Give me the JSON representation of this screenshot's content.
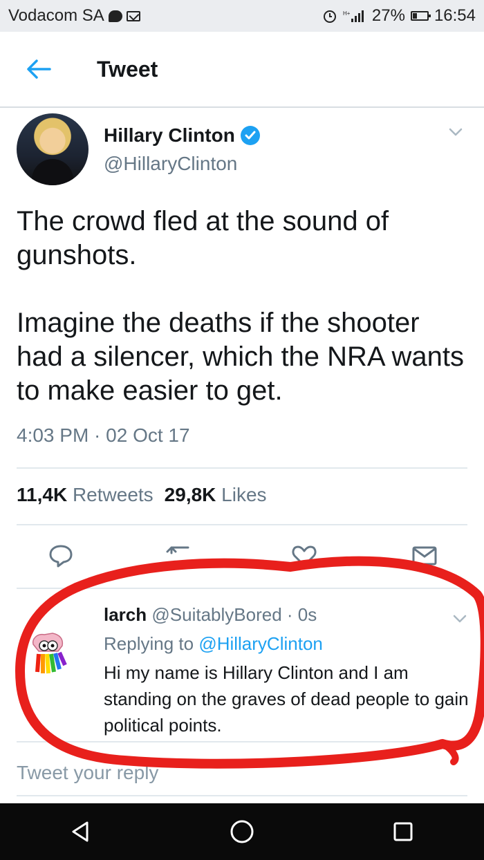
{
  "status_bar": {
    "carrier": "Vodacom SA",
    "battery": "27%",
    "time": "16:54",
    "icons": [
      "chat-icon",
      "mail-icon",
      "alarm-icon",
      "signal-icon",
      "battery-icon"
    ]
  },
  "header": {
    "title": "Tweet",
    "back_icon": "arrow-left-icon"
  },
  "tweet": {
    "author_name": "Hillary Clinton",
    "author_handle": "@HillaryClinton",
    "verified": true,
    "text_paragraphs": [
      "The crowd fled at the sound of gunshots.",
      "Imagine the deaths if the shooter had a silencer, which the NRA wants to make easier to get."
    ],
    "timestamp": "4:03 PM · 02 Oct 17",
    "retweets_count": "11,4K",
    "retweets_label": "Retweets",
    "likes_count": "29,8K",
    "likes_label": "Likes",
    "actions": [
      "reply-icon",
      "retweet-icon",
      "like-icon",
      "share-icon"
    ]
  },
  "reply": {
    "name": "larch",
    "handle_time": "@SuitablyBored · 0s",
    "replying_prefix": "Replying to",
    "replying_to": "@HillaryClinton",
    "text": "Hi my name is Hillary Clinton and I am standing on the graves of dead people to gain political points."
  },
  "compose": {
    "placeholder": "Tweet your reply"
  },
  "nav_bar": {
    "buttons": [
      "back-triangle-icon",
      "home-circle-icon",
      "recents-square-icon"
    ]
  },
  "colors": {
    "accent": "#1da1f2",
    "annotation": "#e8201c",
    "secondary_text": "#657786"
  }
}
